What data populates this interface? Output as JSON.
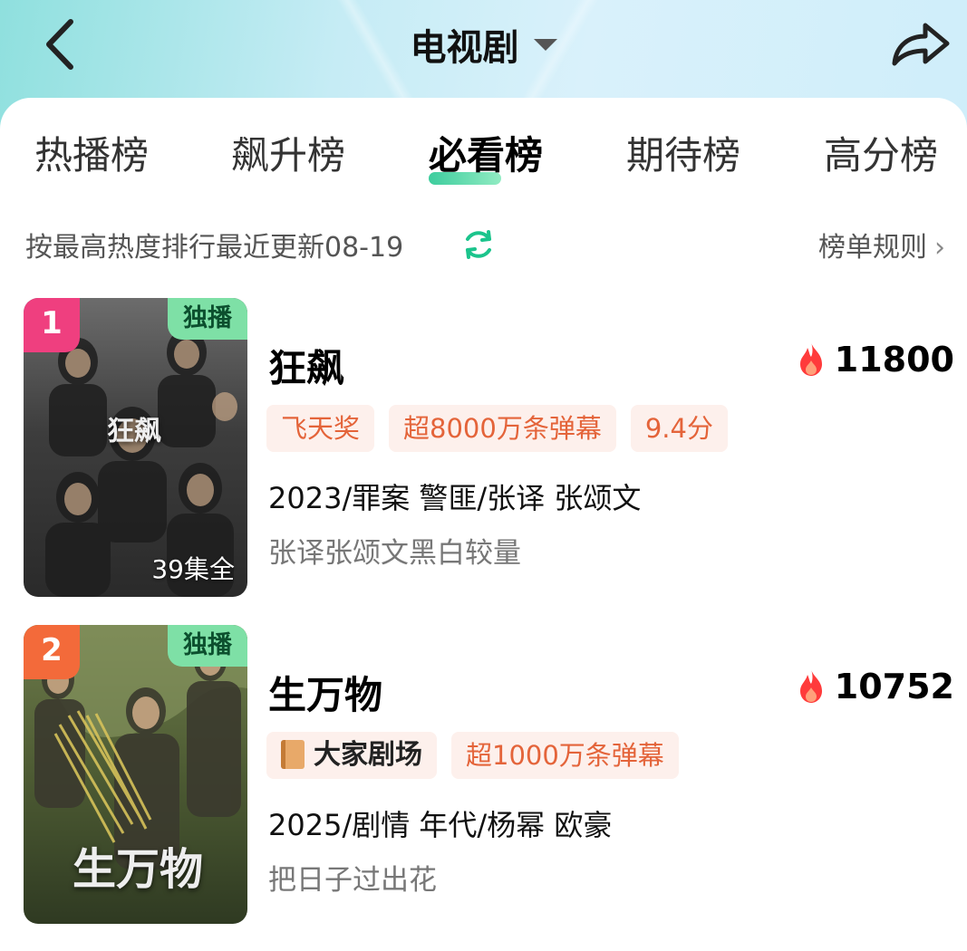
{
  "header": {
    "title": "电视剧",
    "back_icon": "chevron-left-icon",
    "share_icon": "share-arrow-icon"
  },
  "tabs": [
    {
      "label": "热播榜",
      "active": false
    },
    {
      "label": "飙升榜",
      "active": false
    },
    {
      "label": "必看榜",
      "active": true
    },
    {
      "label": "期待榜",
      "active": false
    },
    {
      "label": "高分榜",
      "active": false
    }
  ],
  "subheader": {
    "sort_info": "按最高热度排行最近更新08-19",
    "refresh_icon": "refresh-icon",
    "rules_label": "榜单规则"
  },
  "colors": {
    "accent_green": "#1bc48c",
    "tag_bg": "#fdf0ec",
    "tag_text": "#e4643a",
    "rank1": "#ef3f7f",
    "rank2": "#f36a3a",
    "flame": "#ff3b3b"
  },
  "items": [
    {
      "rank": "1",
      "exclusive": "独播",
      "episodes": "39集全",
      "poster_art_text": "狂飙",
      "name": "狂飙",
      "heat": "11800",
      "tags": [
        "飞天奖",
        "超8000万条弹幕",
        "9.4分"
      ],
      "meta": "2023/罪案 警匪/张译 张颂文",
      "desc": "张译张颂文黑白较量"
    },
    {
      "rank": "2",
      "exclusive": "独播",
      "poster_art_text": "生万物",
      "name": "生万物",
      "heat": "10752",
      "brand_tag": "大家剧场",
      "tags": [
        "超1000万条弹幕"
      ],
      "meta": "2025/剧情 年代/杨幂 欧豪",
      "desc": "把日子过出花"
    }
  ]
}
